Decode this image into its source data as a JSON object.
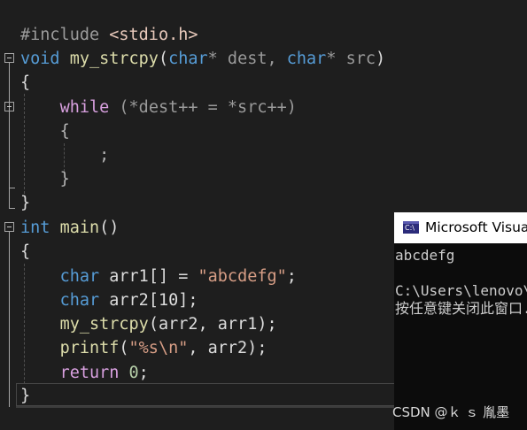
{
  "editor": {
    "code": {
      "include": {
        "directive": "#include",
        "header": "<stdio.h>"
      },
      "strcpy_sig": {
        "ret": "void",
        "name": "my_strcpy",
        "open": "(",
        "t1": "char",
        "p1": "* dest, ",
        "t2": "char",
        "p2": "* src",
        "close": ")"
      },
      "brace_open_1": "{",
      "while_line": {
        "kw": "while",
        "cond": " (*dest++ = *src++)"
      },
      "brace_open_2": "{",
      "empty_stmt": ";",
      "brace_close_2": "}",
      "brace_close_1": "}",
      "main_sig": {
        "ret": "int",
        "name": "main",
        "parens": "()"
      },
      "brace_open_3": "{",
      "decl1": {
        "type": "char",
        "rest": " arr1[] = ",
        "str": "\"abcdefg\"",
        "end": ";"
      },
      "decl2": {
        "type": "char",
        "rest": " arr2[10];"
      },
      "call1": {
        "fn": "my_strcpy",
        "args": "(arr2, arr1);"
      },
      "call2": {
        "fn": "printf",
        "open": "(",
        "fmt": "\"%s\\n\"",
        "rest": ", arr2);"
      },
      "ret": {
        "kw": "return",
        "sp": " ",
        "val": "0",
        "end": ";"
      },
      "brace_close_3": "}"
    }
  },
  "console": {
    "title": "Microsoft Visual Studio Debug Console",
    "icon_label": "C:\\",
    "lines": [
      "abcdefg",
      "",
      "C:\\Users\\lenovo\\source\\repos",
      "按任意键关闭此窗口..."
    ]
  },
  "watermark": "CSDN @ｋ ｓ 胤墨"
}
